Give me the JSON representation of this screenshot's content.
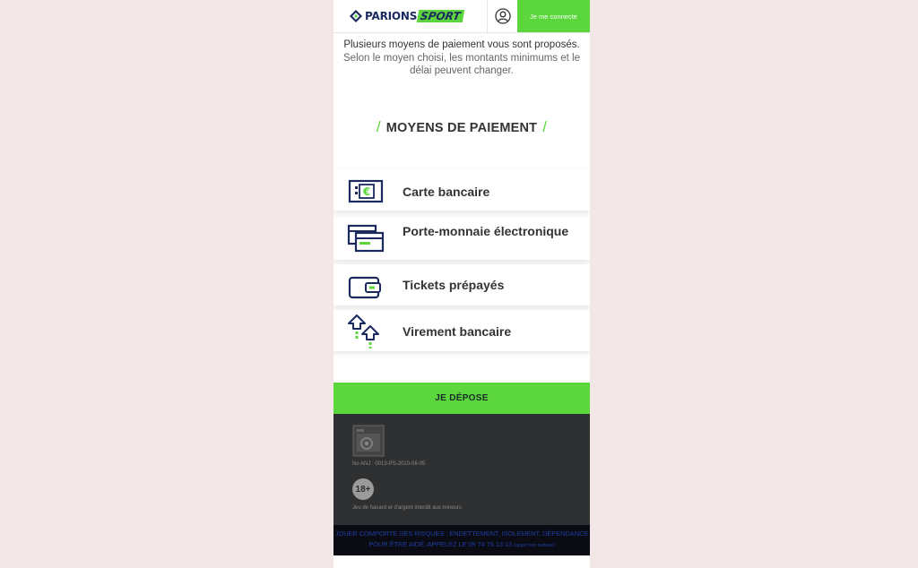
{
  "header": {
    "brand_part1": "PARIONS",
    "brand_part2": "SPORT",
    "user_icon": "user-circle-icon",
    "connect_label": "Je me connecte"
  },
  "intro": {
    "line1": "Plusieurs moyens de paiement vous sont proposés.",
    "line2": "Selon le moyen choisi, les montants minimums et le délai peuvent changer."
  },
  "section": {
    "slash_left": "/",
    "title": "MOYENS DE PAIEMENT",
    "slash_right": "/"
  },
  "payment_methods": [
    {
      "label": "Carte bancaire",
      "icon": "bank-card-euro-icon"
    },
    {
      "label": "Porte-monnaie électronique",
      "icon": "e-wallet-cards-icon"
    },
    {
      "label": "Tickets prépayés",
      "icon": "wallet-icon"
    },
    {
      "label": "Virement bancaire",
      "icon": "transfer-arrows-icon"
    }
  ],
  "cta": {
    "label": "JE DÉPOSE"
  },
  "footer": {
    "anj_number": "No ANJ : 0013-PS-2010-06-05",
    "age_badge": "18+",
    "age_text": "Jeu de hasard et d'argent interdit aux mineurs"
  },
  "warning": {
    "line1": "JOUER COMPORTE DES RISQUES : ENDETTEMENT, ISOLEMENT, DÉPENDANCE",
    "line2": "POUR ÊTRE AIDÉ, APPELEZ LE 09 74 75 13 13",
    "line2_small": "(appel non surtaxé)"
  },
  "colors": {
    "accent_green": "#5bd63c",
    "brand_navy": "#1a2a5e",
    "footer_bg": "#2f3031",
    "page_bg": "#f3e6e6"
  }
}
